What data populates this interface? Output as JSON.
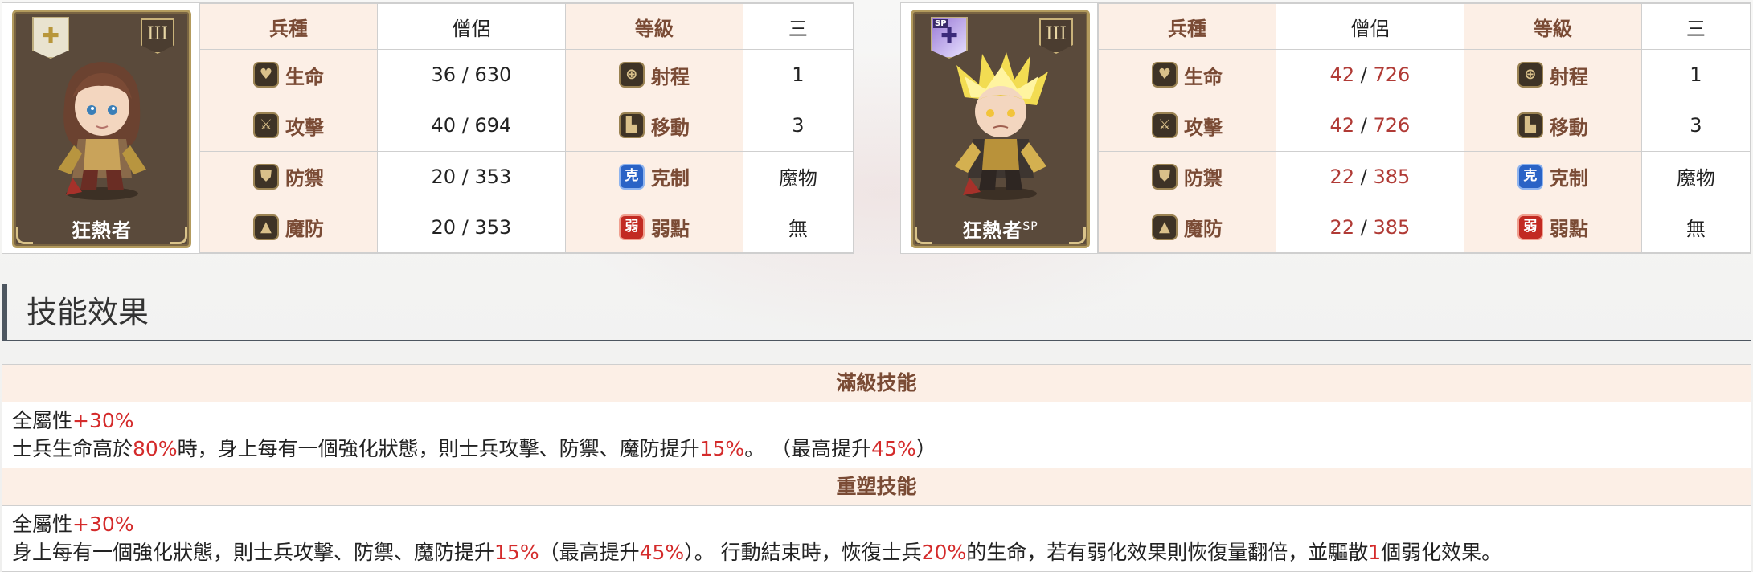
{
  "units": [
    {
      "name": "狂熱者",
      "name_sup": "",
      "rank": "III",
      "emblem_icon": "cross-shield-icon",
      "is_sp": false,
      "header": {
        "type_label": "兵種",
        "type_value": "僧侶",
        "level_label": "等級",
        "level_value": "三"
      },
      "stats": {
        "hp_label": "生命",
        "hp_cur": "36",
        "hp_max": "630",
        "atk_label": "攻擊",
        "atk_cur": "40",
        "atk_max": "694",
        "def_label": "防禦",
        "def_cur": "20",
        "def_max": "353",
        "mdef_label": "魔防",
        "mdef_cur": "20",
        "mdef_max": "353",
        "range_label": "射程",
        "range_value": "1",
        "move_label": "移動",
        "move_value": "3",
        "counter_label": "克制",
        "counter_icon_text": "克",
        "counter_value": "魔物",
        "weak_label": "弱點",
        "weak_icon_text": "弱",
        "weak_value": "無"
      }
    },
    {
      "name": "狂熱者",
      "name_sup": "SP",
      "rank": "III",
      "sp_tag": "SP",
      "emblem_icon": "cross-shield-icon",
      "is_sp": true,
      "header": {
        "type_label": "兵種",
        "type_value": "僧侶",
        "level_label": "等級",
        "level_value": "三"
      },
      "stats": {
        "hp_label": "生命",
        "hp_cur": "42",
        "hp_max": "726",
        "atk_label": "攻擊",
        "atk_cur": "42",
        "atk_max": "726",
        "def_label": "防禦",
        "def_cur": "22",
        "def_max": "385",
        "mdef_label": "魔防",
        "mdef_cur": "22",
        "mdef_max": "385",
        "range_label": "射程",
        "range_value": "1",
        "move_label": "移動",
        "move_value": "3",
        "counter_label": "克制",
        "counter_icon_text": "克",
        "counter_value": "魔物",
        "weak_label": "弱點",
        "weak_icon_text": "弱",
        "weak_value": "無"
      }
    }
  ],
  "stat_separator": "/",
  "section_title": "技能效果",
  "skills": {
    "max_title": "滿級技能",
    "max_line1": {
      "a": "全屬性",
      "b": "+30%"
    },
    "max_line2": {
      "a": "士兵生命高於",
      "b": "80%",
      "c": "時，身上每有一個強化狀態，則士兵攻擊、防禦、魔防提升",
      "d": "15%",
      "e": "。 （最高提升",
      "f": "45%",
      "g": "）"
    },
    "remold_title": "重塑技能",
    "remold_line1": {
      "a": "全屬性",
      "b": "+30%"
    },
    "remold_line2": {
      "a": "身上每有一個強化狀態，則士兵攻擊、防禦、魔防提升",
      "b": "15%",
      "c": "（最高提升",
      "d": "45%",
      "e": "）。 行動結束時，恢復士兵",
      "f": "20%",
      "g": "的生命，若有弱化效果則恢復量翻倍，並驅散",
      "h": "1",
      "i": "個弱化效果。"
    }
  },
  "colors": {
    "label_bg": "#fcefe6",
    "label_text": "#7a4b35",
    "highlight_red": "#d42b2b",
    "sp_value_red": "#b03a35"
  }
}
